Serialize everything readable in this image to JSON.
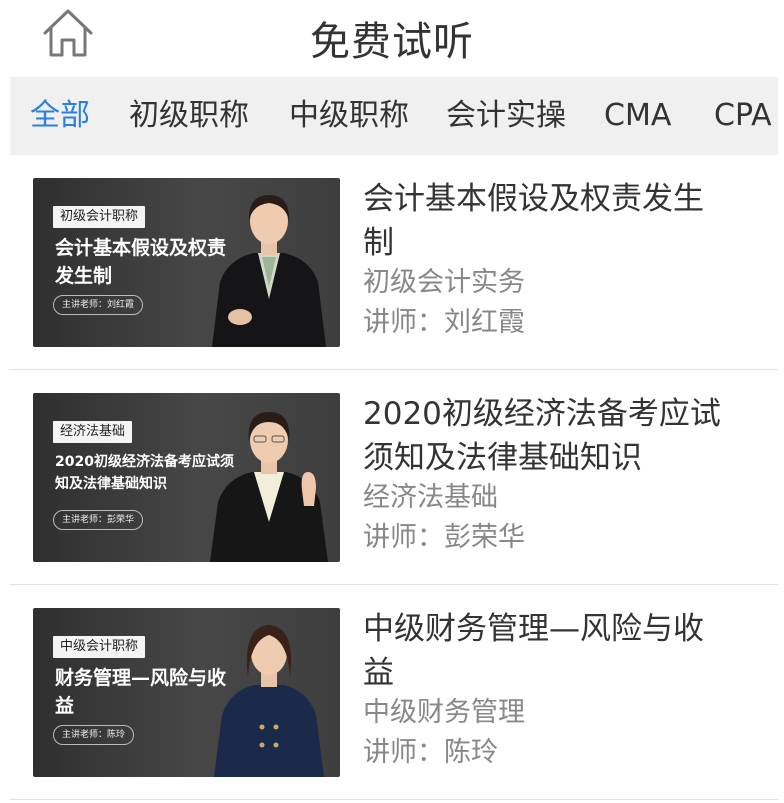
{
  "header": {
    "title": "免费试听",
    "home_icon": "home-icon"
  },
  "tabs": [
    {
      "label": "全部",
      "active": true
    },
    {
      "label": "初级职称",
      "active": false
    },
    {
      "label": "中级职称",
      "active": false
    },
    {
      "label": "会计实操",
      "active": false
    },
    {
      "label": "CMA",
      "active": false
    },
    {
      "label": "CPA",
      "active": false
    }
  ],
  "courses": [
    {
      "title": "会计基本假设及权责发生制",
      "category": "初级会计实务",
      "teacher_label": "讲师：",
      "teacher": "刘红霞",
      "thumb": {
        "badge": "初级会计职称",
        "title": "会计基本假设及权责发生制",
        "lecturer": "主讲老师：刘红霞"
      }
    },
    {
      "title": "2020初级经济法备考应试须知及法律基础知识",
      "category": "经济法基础",
      "teacher_label": "讲师：",
      "teacher": "彭荣华",
      "thumb": {
        "badge": "经济法基础",
        "title": "2020初级经济法备考应试须知及法律基础知识",
        "lecturer": "主讲老师：彭荣华"
      }
    },
    {
      "title": "中级财务管理—风险与收益",
      "category": "中级财务管理",
      "teacher_label": "讲师：",
      "teacher": "陈玲",
      "thumb": {
        "badge": "中级会计职称",
        "title": "财务管理—风险与收益",
        "lecturer": "主讲老师：陈玲"
      }
    }
  ],
  "colors": {
    "accent": "#2b7fe0",
    "tab_bar_bg": "#f0f0f0",
    "thumb_bg": "#3a3a3a"
  }
}
